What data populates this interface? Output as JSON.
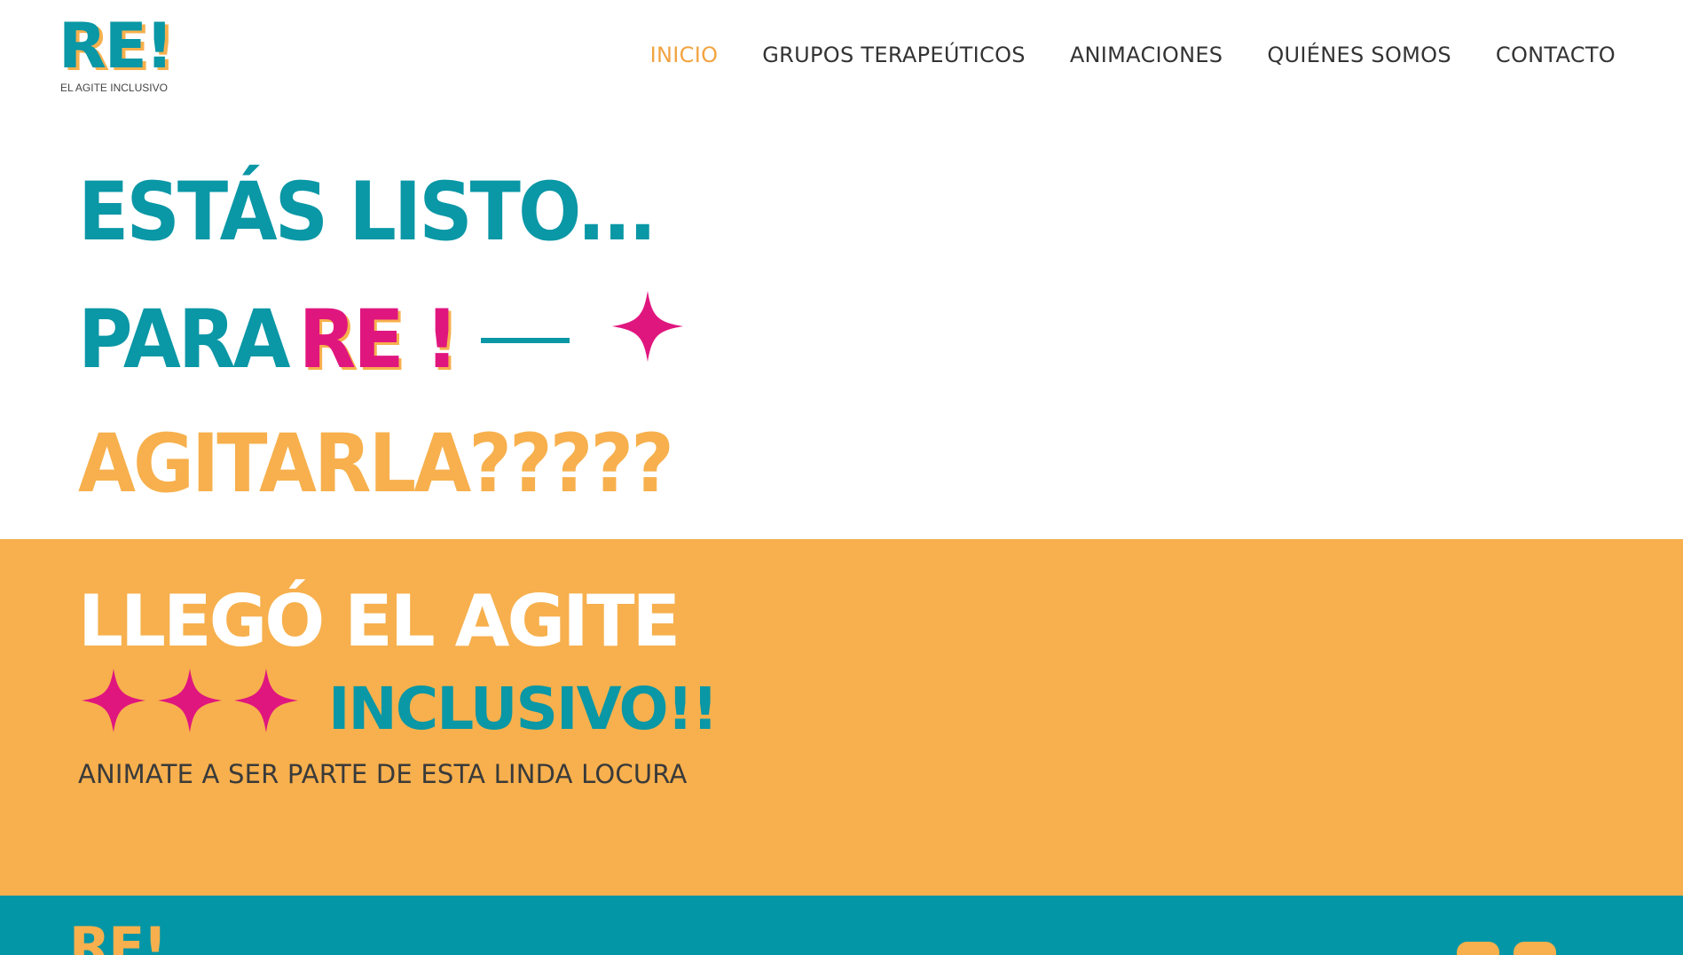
{
  "header": {
    "logo_text": "RE!",
    "logo_tagline": "EL AGITE INCLUSIVO",
    "nav": [
      {
        "label": "INICIO",
        "active": true
      },
      {
        "label": "GRUPOS TERAPEÚTICOS",
        "active": false
      },
      {
        "label": "ANIMACIONES",
        "active": false
      },
      {
        "label": "QUIÉNES SOMOS",
        "active": false
      },
      {
        "label": "CONTACTO",
        "active": false
      }
    ]
  },
  "hero": {
    "line1": "ESTÁS LISTO...",
    "line2_prefix": "PARA",
    "line2_highlight": "RE !",
    "line3": "AGITARLA?????"
  },
  "band": {
    "title": "LLEGÓ EL AGITE",
    "subtitle": "INCLUSIVO!!",
    "text": "ANIMATE A SER PARTE DE ESTA LINDA LOCURA"
  },
  "footer": {
    "logo_text": "RE!",
    "social_icons": [
      "instagram-icon",
      "facebook-icon"
    ]
  },
  "colors": {
    "teal": "#0a97a6",
    "orange": "#f7b04d",
    "magenta": "#e0167f",
    "footer_bg": "#0396a6"
  }
}
